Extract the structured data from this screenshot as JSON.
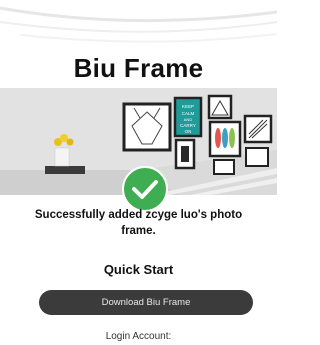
{
  "header": {
    "title": "Biu Frame"
  },
  "hero": {
    "poster_text": [
      "KEEP",
      "CALM",
      "AND",
      "CARRY",
      "ON"
    ],
    "poster_color": "#1f9c9a"
  },
  "status": {
    "success_message": "Successfully added zcyge luo's photo frame.",
    "success_color": "#3fae52"
  },
  "quick_start": {
    "heading": "Quick Start",
    "download_label": "Download Biu Frame",
    "login_label": "Login Account:"
  }
}
